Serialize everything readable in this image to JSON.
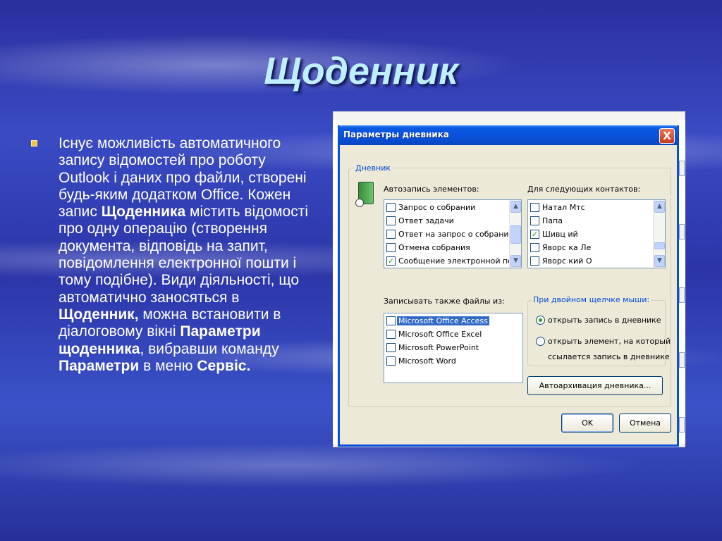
{
  "slide": {
    "title": "Щоденник",
    "bullet": {
      "t1": "Існує можливість автоматичного запису відомостей про роботу Outlook і даних про файли, створені будь-яким додатком Office. Кожен запис ",
      "b1": "Щоденника",
      "t2": " містить відомості про одну операцію (створення документа, відповідь на запит, повідомлення електронної пошти і тому подібне). Види діяльності, що автоматично заносяться в ",
      "b2": "Щоденник,",
      "t3": " можна встановити в діалоговому вікні ",
      "b3": "Параметри щоденника",
      "t4": ", вибравши команду ",
      "b4": "Параметри",
      "t5": " в меню ",
      "b5": "Сервіс."
    }
  },
  "dialog": {
    "title": "Параметры дневника",
    "close_glyph": "X",
    "group_journal": "Дневник",
    "autorecord_label": "Автозапись элементов:",
    "contacts_label": "Для следующих контактов:",
    "autorecord_items": [
      {
        "label": "Запрос о собрании",
        "checked": false
      },
      {
        "label": "Ответ задачи",
        "checked": false
      },
      {
        "label": "Ответ на запрос о собрании",
        "checked": false
      },
      {
        "label": "Отмена собрания",
        "checked": false
      },
      {
        "label": "Сообщение электронной почты",
        "checked": true
      }
    ],
    "contact_items": [
      {
        "label": "Натал Мтс",
        "checked": false
      },
      {
        "label": "Папа",
        "checked": false
      },
      {
        "label": "Шивц ий",
        "checked": true
      },
      {
        "label": "Яворс ка Ле",
        "checked": false
      },
      {
        "label": "Яворс кий О",
        "checked": false
      }
    ],
    "files_label": "Записывать также файлы из:",
    "file_items": [
      {
        "label": "Microsoft Office Access",
        "checked": false,
        "selected": true
      },
      {
        "label": "Microsoft Office Excel",
        "checked": false,
        "selected": false
      },
      {
        "label": "Microsoft PowerPoint",
        "checked": false,
        "selected": false
      },
      {
        "label": "Microsoft Word",
        "checked": false,
        "selected": false
      }
    ],
    "dblclick_group": "При двойном щелчке мыши:",
    "radio_open_record": "открыть запись в дневнике",
    "radio_open_item_l1": "открыть элемент, на который",
    "radio_open_item_l2": "ссылается запись в дневнике",
    "radio_selected": "open_record",
    "autoarchive_button": "Автоархивация дневника...",
    "ok_button": "OK",
    "cancel_button": "Отмена",
    "colors": {
      "titlebar": "#0a50d8",
      "dialog_bg": "#ece9d8",
      "selection": "#316ac5"
    }
  }
}
